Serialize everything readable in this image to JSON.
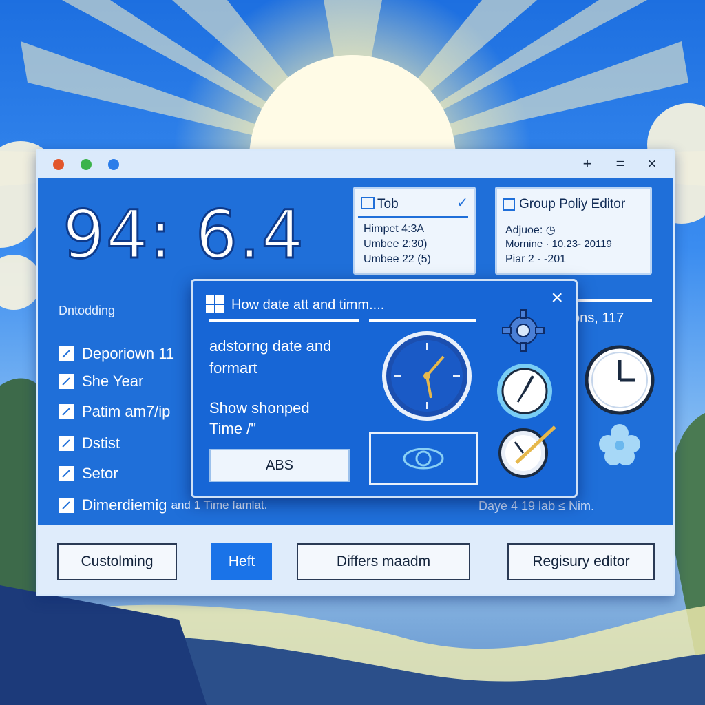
{
  "window": {
    "controls": {
      "add": "+",
      "minimize": "=",
      "close": "×"
    },
    "dot_colors": [
      "#e2562b",
      "#3cb34a",
      "#2b7de9"
    ]
  },
  "clock": {
    "time": "94: 6.4"
  },
  "tab_panel": {
    "title": "Tob",
    "lines": [
      "Himpet 4:3A",
      "Umbee 2:30)",
      "Umbee 22 (5)"
    ]
  },
  "gpe_panel": {
    "title": "Group Poliy Editor",
    "lines": [
      "Adjuoe: ◷",
      "Mornine · 10.23- 20119",
      "Piar 2 - -201"
    ]
  },
  "sidebar": {
    "label": "Dntodding",
    "items": [
      {
        "label": "Deporiown 11"
      },
      {
        "label": "She Year"
      },
      {
        "label": "Patim am7/ip"
      },
      {
        "label": "Dstist"
      },
      {
        "label": "Setor"
      },
      {
        "label": "Dimerdiemig"
      }
    ],
    "trailing": "and 1 Time famlat."
  },
  "right_area": {
    "label": "ons, 117",
    "bottom": "Daye 4 19 lab ≤ Nim."
  },
  "dialog": {
    "title": "How date att and timm....",
    "heading1": "adstorng date and",
    "heading2": "formart",
    "show1": "Show shonped",
    "show2": "Time /\"",
    "button": "ABS",
    "close": "×"
  },
  "footer": {
    "buttons": [
      {
        "label": "Custolming"
      },
      {
        "label": "Heft"
      },
      {
        "label": "Differs maadm"
      },
      {
        "label": "Regisury editor"
      }
    ]
  },
  "colors": {
    "accent": "#1a73e8",
    "window_bg": "#1f6fd9",
    "dialog_bg": "#1766d6"
  }
}
